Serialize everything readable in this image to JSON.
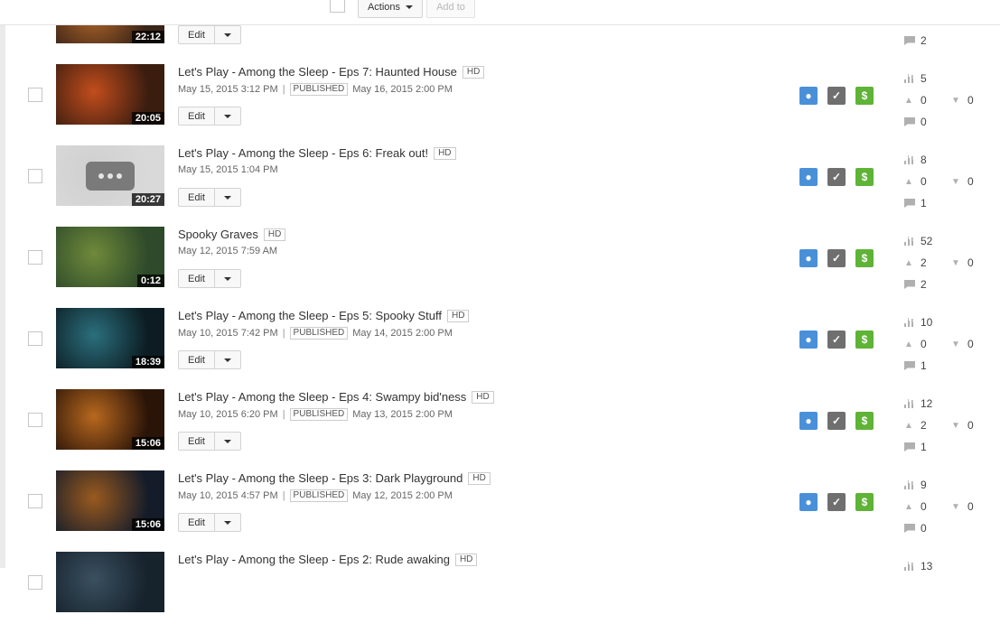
{
  "toolbar": {
    "actions_label": "Actions",
    "add_to_label": "Add to"
  },
  "colors": {
    "public": "#4a90d9",
    "check": "#6f6f6f",
    "monetized": "#5fb336"
  },
  "videos": [
    {
      "title": "",
      "hd": "",
      "date": "",
      "published_label": "",
      "published_date": "",
      "duration": "22:12",
      "edit_label": "Edit",
      "views": "",
      "likes": "",
      "dislikes": "",
      "comments": "2",
      "thumb_colors": [
        "#3a2418",
        "#b86a2a"
      ]
    },
    {
      "title": "Let's Play - Among the Sleep - Eps 7: Haunted House",
      "hd": "HD",
      "date": "May 15, 2015 3:12 PM",
      "published_label": "PUBLISHED",
      "published_date": "May 16, 2015 2:00 PM",
      "duration": "20:05",
      "edit_label": "Edit",
      "views": "5",
      "likes": "0",
      "dislikes": "0",
      "comments": "0",
      "thumb_colors": [
        "#3b1d10",
        "#c24d1c"
      ]
    },
    {
      "title": "Let's Play - Among the Sleep - Eps 6: Freak out!",
      "hd": "HD",
      "date": "May 15, 2015 1:04 PM",
      "published_label": "",
      "published_date": "",
      "duration": "20:27",
      "edit_label": "Edit",
      "views": "8",
      "likes": "0",
      "dislikes": "0",
      "comments": "1",
      "thumb_colors": [
        "#d9d9d9",
        "#cfcfcf"
      ],
      "placeholder": true
    },
    {
      "title": "Spooky Graves",
      "hd": "HD",
      "date": "May 12, 2015 7:59 AM",
      "published_label": "",
      "published_date": "",
      "duration": "0:12",
      "edit_label": "Edit",
      "views": "52",
      "likes": "2",
      "dislikes": "0",
      "comments": "2",
      "thumb_colors": [
        "#2e4a2a",
        "#6f8a3a"
      ]
    },
    {
      "title": "Let's Play - Among the Sleep - Eps 5: Spooky Stuff",
      "hd": "HD",
      "date": "May 10, 2015 7:42 PM",
      "published_label": "PUBLISHED",
      "published_date": "May 14, 2015 2:00 PM",
      "duration": "18:39",
      "edit_label": "Edit",
      "views": "10",
      "likes": "0",
      "dislikes": "0",
      "comments": "1",
      "thumb_colors": [
        "#0c1c22",
        "#2b6f7d"
      ]
    },
    {
      "title": "Let's Play - Among the Sleep - Eps 4: Swampy bid'ness",
      "hd": "HD",
      "date": "May 10, 2015 6:20 PM",
      "published_label": "PUBLISHED",
      "published_date": "May 13, 2015 2:00 PM",
      "duration": "15:06",
      "edit_label": "Edit",
      "views": "12",
      "likes": "2",
      "dislikes": "0",
      "comments": "1",
      "thumb_colors": [
        "#2a1408",
        "#b8681e"
      ]
    },
    {
      "title": "Let's Play - Among the Sleep - Eps 3: Dark Playground",
      "hd": "HD",
      "date": "May 10, 2015 4:57 PM",
      "published_label": "PUBLISHED",
      "published_date": "May 12, 2015 2:00 PM",
      "duration": "15:06",
      "edit_label": "Edit",
      "views": "9",
      "likes": "0",
      "dislikes": "0",
      "comments": "0",
      "thumb_colors": [
        "#141c2a",
        "#9a5a1e"
      ]
    },
    {
      "title": "Let's Play - Among the Sleep - Eps 2: Rude awaking",
      "hd": "HD",
      "date": "",
      "published_label": "",
      "published_date": "",
      "duration": "",
      "edit_label": "",
      "views": "13",
      "likes": "",
      "dislikes": "",
      "comments": "",
      "thumb_colors": [
        "#16222c",
        "#3a5060"
      ]
    }
  ]
}
